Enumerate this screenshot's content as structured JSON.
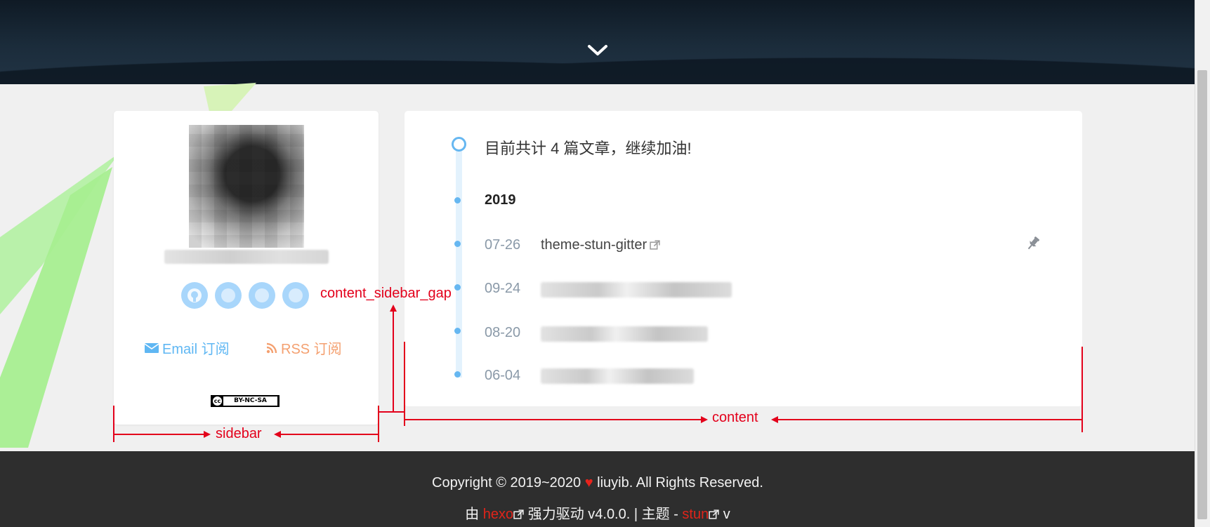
{
  "hero": {
    "scroll_icon": "chevron-down-icon"
  },
  "sidebar": {
    "social_icons": [
      "github-icon",
      "weibo-icon",
      "social-icon-3",
      "social-icon-4"
    ],
    "email_label": "Email 订阅",
    "rss_label": "RSS 订阅",
    "license": {
      "cc": "cc",
      "text": "BY-NC-SA"
    }
  },
  "content": {
    "summary": "目前共计 4 篇文章，继续加油!",
    "year": "2019",
    "posts": [
      {
        "date": "07-26",
        "title": "theme-stun-gitter",
        "pinned": true
      },
      {
        "date": "09-24",
        "title": ""
      },
      {
        "date": "08-20",
        "title": ""
      },
      {
        "date": "06-04",
        "title": ""
      }
    ]
  },
  "footer": {
    "copyright_a": "Copyright © 2019~2020",
    "copyright_b": "liuyib. All Rights Reserved.",
    "powered_prefix": "由",
    "hexo": "hexo",
    "powered_suffix": "强力驱动 v4.0.0.",
    "separator": "|",
    "theme_prefix": "主题 -",
    "stun": "stun",
    "version_prefix": "v"
  },
  "annotations": {
    "gap": "content_sidebar_gap",
    "sidebar": "sidebar",
    "content": "content"
  },
  "colors": {
    "accent": "#66b7f1",
    "rss": "#f4a070",
    "annotation": "#e3001b",
    "footer_bg": "#2e2e2e"
  }
}
